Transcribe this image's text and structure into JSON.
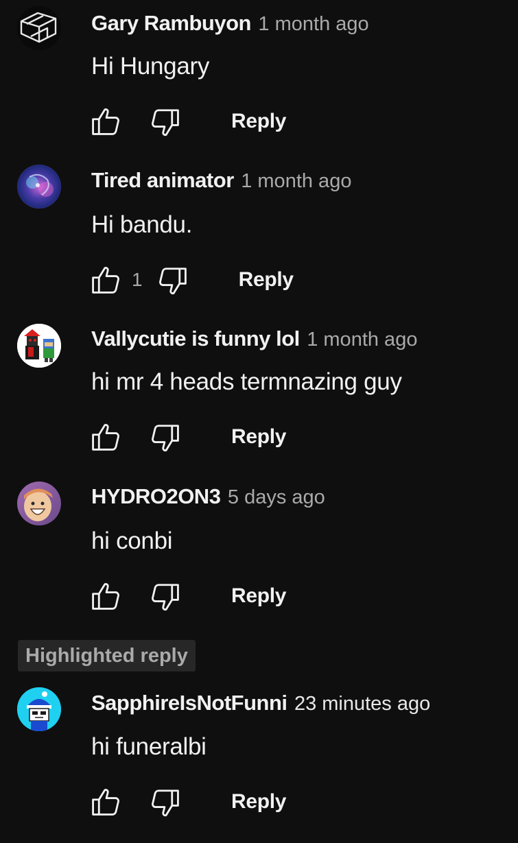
{
  "comments": [
    {
      "author": "Gary Rambuyon",
      "time": "1 month ago",
      "text": "Hi Hungary",
      "likes": "",
      "reply_label": "Reply",
      "avatar_icon": "cube-logo-avatar"
    },
    {
      "author": "Tired animator",
      "time": "1 month ago",
      "text": "Hi bandu.",
      "likes": "1",
      "reply_label": "Reply",
      "avatar_icon": "galaxy-avatar"
    },
    {
      "author": "Vallycutie is funny lol",
      "time": "1 month ago",
      "text": "hi mr 4 heads termnazing guy",
      "likes": "",
      "reply_label": "Reply",
      "avatar_icon": "characters-avatar"
    },
    {
      "author": "HYDRO2ON3",
      "time": "5 days ago",
      "text": "hi conbi",
      "likes": "",
      "reply_label": "Reply",
      "avatar_icon": "smiley-face-avatar"
    },
    {
      "author": "SapphireIsNotFunni",
      "time": "23 minutes ago",
      "text": "hi funeralbi",
      "likes": "",
      "reply_label": "Reply",
      "avatar_icon": "blue-hat-character-avatar"
    }
  ],
  "highlighted_label": "Highlighted reply",
  "colors": {
    "background": "#0f0f0f",
    "primary_text": "#f1f1f1",
    "secondary_text": "#aaaaaa",
    "badge_background": "#272727"
  }
}
